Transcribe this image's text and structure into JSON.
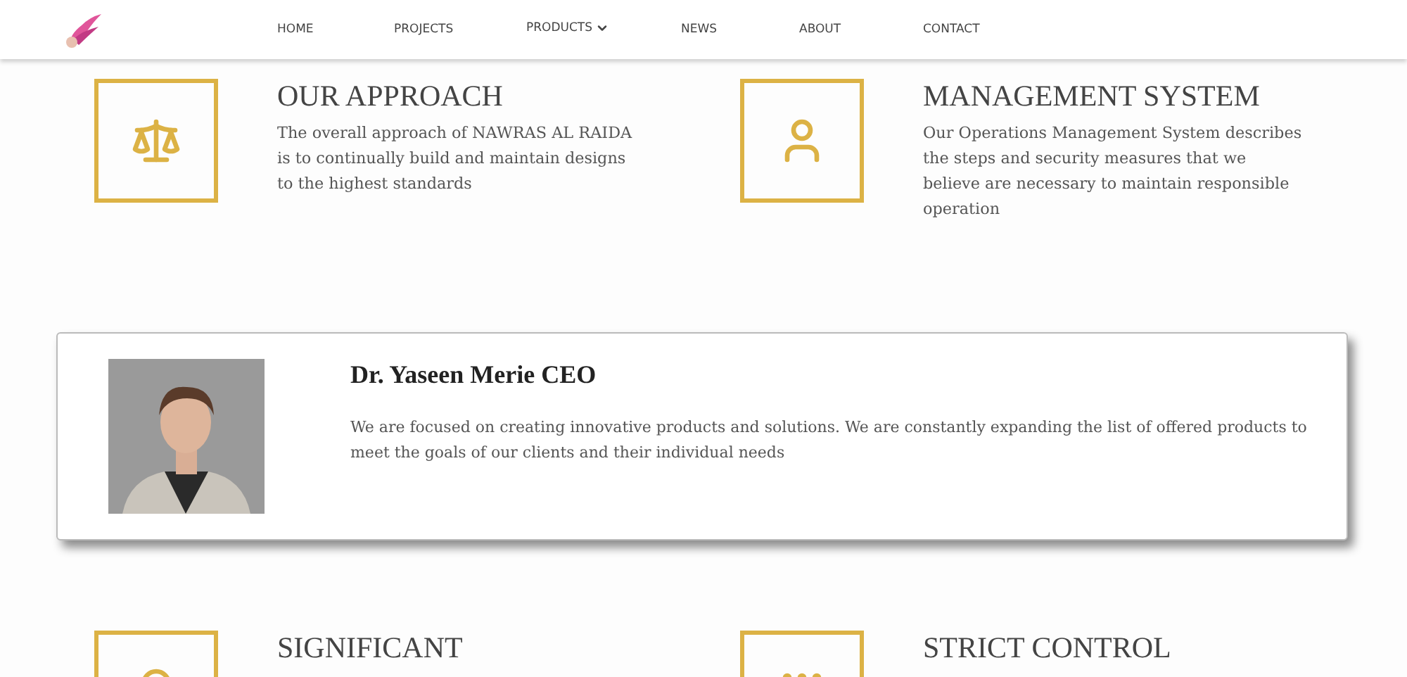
{
  "nav": {
    "items": [
      {
        "label": "HOME",
        "dropdown": false
      },
      {
        "label": "PROJECTS",
        "dropdown": false
      },
      {
        "label": "PRODUCTS",
        "dropdown": true
      },
      {
        "label": "NEWS",
        "dropdown": false
      },
      {
        "label": "ABOUT",
        "dropdown": false
      },
      {
        "label": "CONTACT",
        "dropdown": false
      }
    ]
  },
  "features_top": [
    {
      "title": "OUR APPROACH",
      "text": "The overall approach of NAWRAS AL RAIDA is to continually build and maintain designs to the highest standards"
    },
    {
      "title": "MANAGEMENT SYSTEM",
      "text": "Our Operations Management System describes the steps and security measures that we believe are necessary to maintain responsible operation"
    }
  ],
  "ceo_card": {
    "name": "Dr. Yaseen Merie CEO",
    "text": "We are focused on creating innovative products and solutions. We are constantly expanding the list of offered products to meet the goals of our clients and their individual needs"
  },
  "features_bottom": [
    {
      "title": "SIGNIFICANT"
    },
    {
      "title": "STRICT CONTROL"
    }
  ]
}
